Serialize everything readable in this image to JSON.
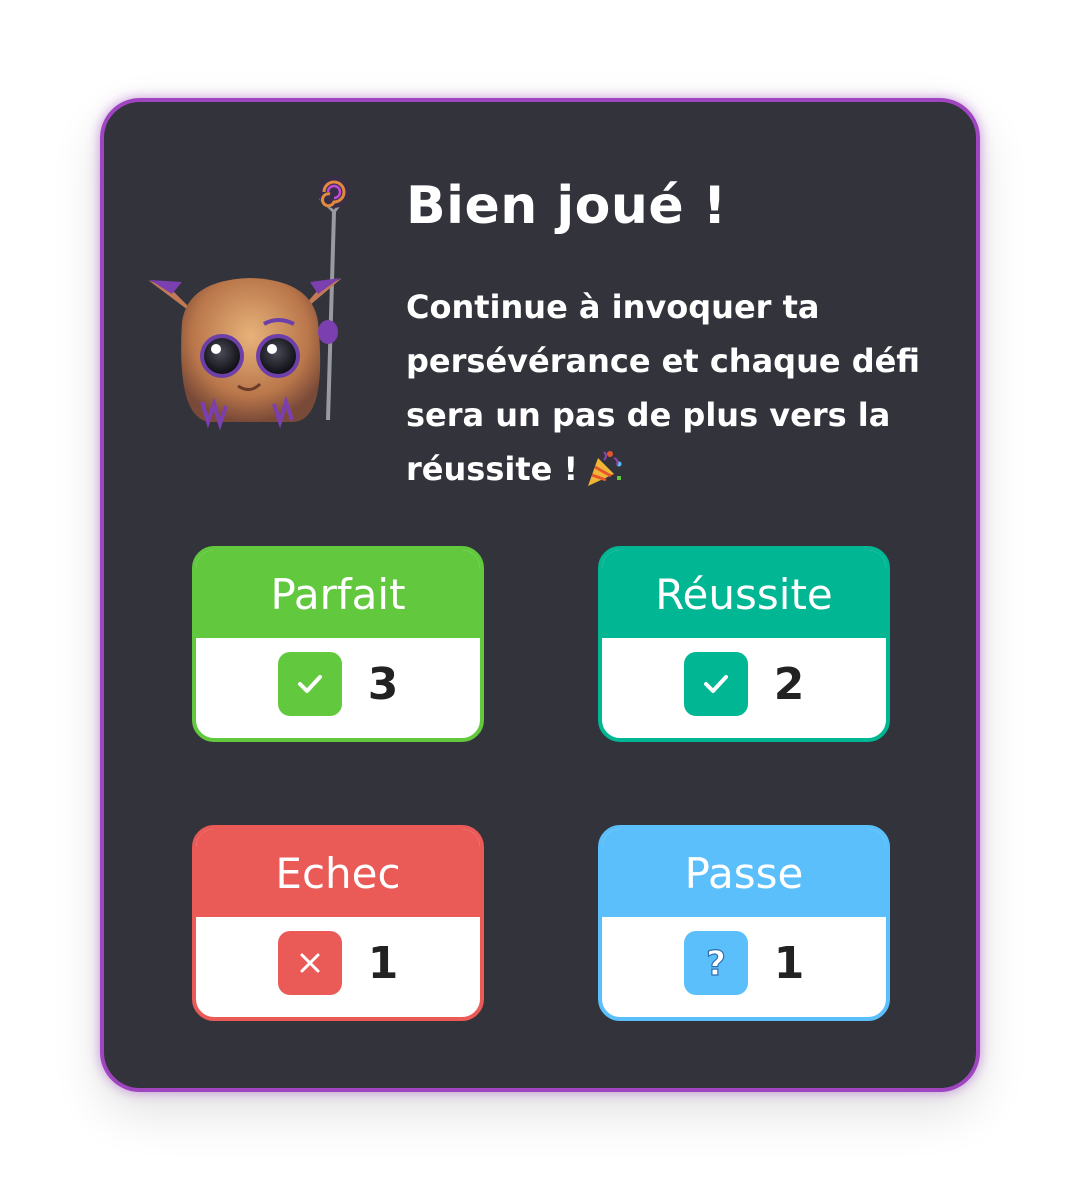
{
  "dialog": {
    "title": "Bien joué !",
    "message": "Continue à invoquer ta persévérance et chaque défi sera un pas de plus vers la réussite !",
    "message_emoji": "party-popper-icon",
    "mascot": "wizard-creature-with-staff"
  },
  "colors": {
    "card_background": "#32333b",
    "card_border": "#9f45bf",
    "parfait": "#62c93e",
    "reussite": "#00b693",
    "echec": "#ea5a57",
    "passe": "#5bbffc"
  },
  "stats": [
    {
      "label": "Parfait",
      "count": "3",
      "icon": "check-icon"
    },
    {
      "label": "Réussite",
      "count": "2",
      "icon": "check-icon"
    },
    {
      "label": "Echec",
      "count": "1",
      "icon": "cross-icon"
    },
    {
      "label": "Passe",
      "count": "1",
      "icon": "question-icon"
    }
  ]
}
